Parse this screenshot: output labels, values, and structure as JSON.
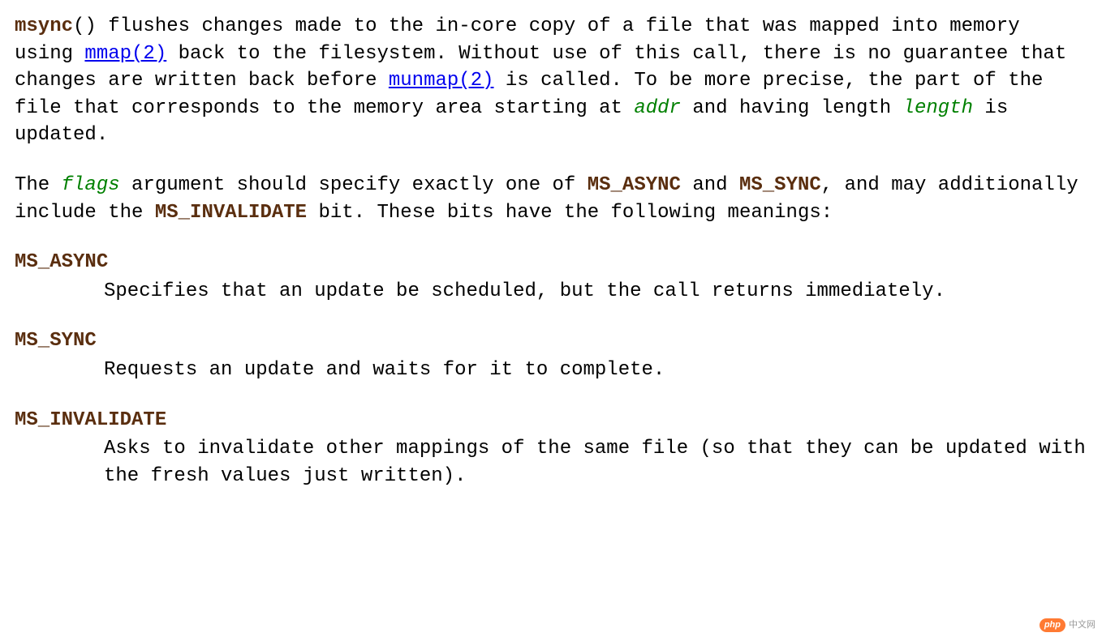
{
  "para1": {
    "t1": "msync",
    "t2": "() flushes changes made to the in-core copy of a file that was mapped into memory using ",
    "link1": "mmap(2)",
    "t3": " back to the filesystem.  Without use of this call, there is no guarantee that changes are written back before ",
    "link2": "munmap(2)",
    "t4": " is called.  To be more precise, the part of the file that corresponds to the memory area starting at ",
    "param1": "addr",
    "t5": " and having length ",
    "param2": "length",
    "t6": " is updated."
  },
  "para2": {
    "t1": "The ",
    "param1": "flags",
    "t2": " argument should specify exactly one of ",
    "b1": "MS_ASYNC",
    "t3": " and ",
    "b2": "MS_SYNC",
    "t4": ", and may additionally include the ",
    "b3": "MS_INVALIDATE",
    "t5": " bit.  These bits have the following meanings:"
  },
  "defs": {
    "d1": {
      "term": "MS_ASYNC",
      "body": "Specifies that an update be scheduled, but the call returns immediately."
    },
    "d2": {
      "term": "MS_SYNC",
      "body": "Requests an update and waits for it to complete."
    },
    "d3": {
      "term": "MS_INVALIDATE",
      "body": "Asks to invalidate other mappings of the same file (so that they can be updated with the fresh values just written)."
    }
  },
  "watermark": {
    "badge": "php",
    "text": "中文网"
  }
}
